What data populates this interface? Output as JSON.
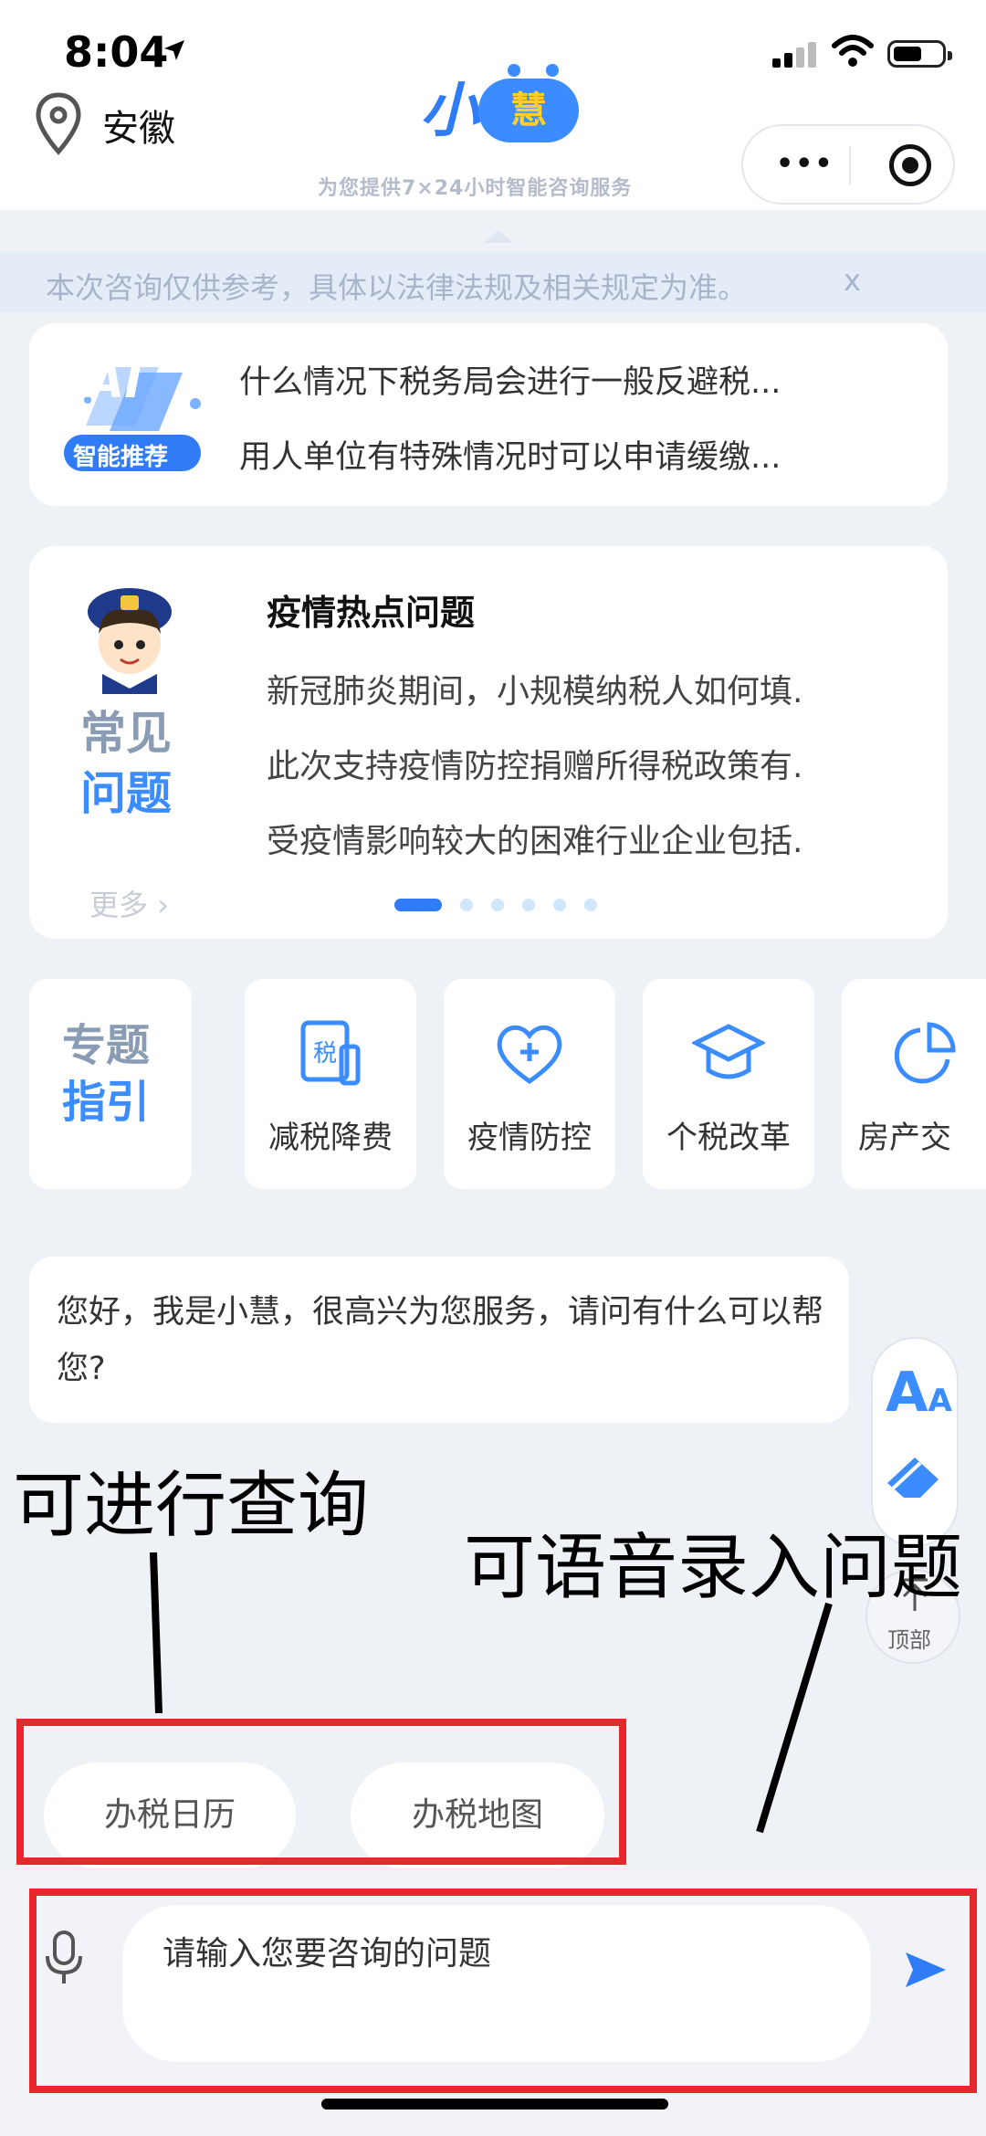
{
  "status_bar": {
    "time": "8:04"
  },
  "header": {
    "location": "安徽",
    "logo_xiao": "小",
    "logo_hui": "慧",
    "tagline": "为您提供7×24小时智能咨询服务",
    "menu_dots": "•••"
  },
  "notice": {
    "text": "本次咨询仅供参考，具体以法律法规及相关规定为准。",
    "close": "x"
  },
  "ai_recommend": {
    "badge_ai": "AI",
    "badge_label": "智能推荐",
    "questions": [
      "什么情况下税务局会进行一般反避税...",
      "用人单位有特殊情况时可以申请缓缴..."
    ]
  },
  "faq": {
    "label_line1": "常见",
    "label_line2": "问题",
    "title": "疫情热点问题",
    "questions": [
      "新冠肺炎期间，小规模纳税人如何填.",
      "此次支持疫情防控捐赠所得税政策有.",
      "受疫情影响较大的困难行业企业包括."
    ],
    "more": "更多",
    "pages_total": 6,
    "page_active": 1
  },
  "topics": {
    "label_line1": "专题",
    "label_line2": "指引",
    "items": [
      {
        "label": "减税降费",
        "icon": "tax-document-icon",
        "icon_text": "税"
      },
      {
        "label": "疫情防控",
        "icon": "heart-plus-icon"
      },
      {
        "label": "个税改革",
        "icon": "graduation-cap-icon"
      },
      {
        "label": "房产交",
        "icon": "pie-chart-icon"
      }
    ]
  },
  "chat": {
    "greeting": "您好，我是小慧，很高兴为您服务，请问有什么可以帮您?"
  },
  "side_tools": {
    "font_icon": "font-size-icon",
    "font_label": "A",
    "font_label_small": "A",
    "erase_icon": "eraser-icon",
    "top_label": "顶部"
  },
  "annotations": {
    "query": "可进行查询",
    "voice": "可语音录入问题"
  },
  "quick_actions": [
    "办税日历",
    "办税地图"
  ],
  "input": {
    "placeholder": "请输入您要咨询的问题"
  },
  "colors": {
    "accent": "#2f7cf6",
    "annotation_red": "#e8272c",
    "logo_yellow": "#ffd02b"
  }
}
